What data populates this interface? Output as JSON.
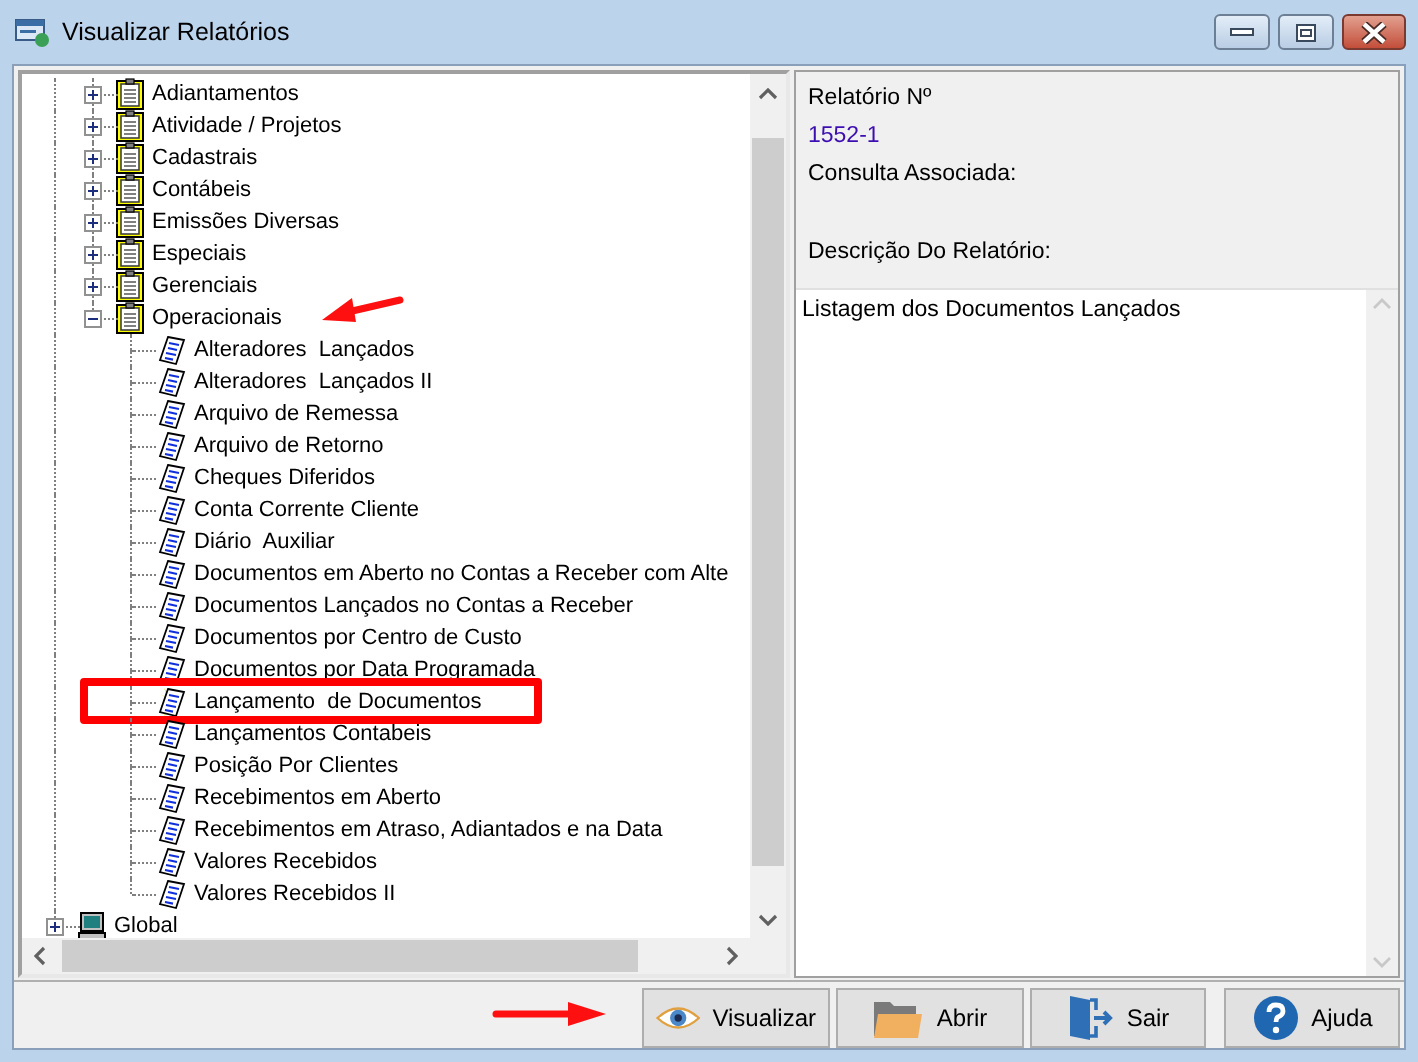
{
  "window": {
    "title": "Visualizar Relatórios"
  },
  "tree": [
    {
      "children": [
        {
          "label": "Adiantamentos",
          "kind": "category",
          "expanded": false
        },
        {
          "label": "Atividade / Projetos",
          "kind": "category",
          "expanded": false
        },
        {
          "label": "Cadastrais",
          "kind": "category",
          "expanded": false
        },
        {
          "label": "Contábeis",
          "kind": "category",
          "expanded": false
        },
        {
          "label": "Emissões Diversas",
          "kind": "category",
          "expanded": false
        },
        {
          "label": "Especiais",
          "kind": "category",
          "expanded": false
        },
        {
          "label": "Gerenciais",
          "kind": "category",
          "expanded": false
        },
        {
          "label": "Operacionais",
          "kind": "category",
          "expanded": true,
          "children": [
            {
              "label": "Alteradores  Lançados",
              "kind": "report",
              "selected": false,
              "highlighted": false
            },
            {
              "label": "Alteradores  Lançados II",
              "kind": "report",
              "selected": false,
              "highlighted": false
            },
            {
              "label": "Arquivo de Remessa",
              "kind": "report",
              "selected": false,
              "highlighted": false
            },
            {
              "label": "Arquivo de Retorno",
              "kind": "report",
              "selected": false,
              "highlighted": false
            },
            {
              "label": "Cheques Diferidos",
              "kind": "report",
              "selected": false,
              "highlighted": false
            },
            {
              "label": "Conta Corrente Cliente",
              "kind": "report",
              "selected": false,
              "highlighted": false
            },
            {
              "label": "Diário  Auxiliar",
              "kind": "report",
              "selected": false,
              "highlighted": false
            },
            {
              "label": "Documentos em Aberto no Contas a Receber com Alte",
              "kind": "report",
              "selected": false,
              "highlighted": false
            },
            {
              "label": "Documentos Lançados no Contas a Receber",
              "kind": "report",
              "selected": false,
              "highlighted": false
            },
            {
              "label": "Documentos por Centro de Custo",
              "kind": "report",
              "selected": false,
              "highlighted": false
            },
            {
              "label": "Documentos por Data Programada",
              "kind": "report",
              "selected": false,
              "highlighted": false
            },
            {
              "label": "Lançamento  de Documentos",
              "kind": "report",
              "selected": true,
              "highlighted": true
            },
            {
              "label": "Lançamentos Contabeis",
              "kind": "report",
              "selected": false,
              "highlighted": false
            },
            {
              "label": "Posição Por Clientes",
              "kind": "report",
              "selected": false,
              "highlighted": false
            },
            {
              "label": "Recebimentos em Aberto",
              "kind": "report",
              "selected": false,
              "highlighted": false
            },
            {
              "label": "Recebimentos em Atraso, Adiantados e na Data",
              "kind": "report",
              "selected": false,
              "highlighted": false
            },
            {
              "label": "Valores Recebidos",
              "kind": "report",
              "selected": false,
              "highlighted": false
            },
            {
              "label": "Valores Recebidos II",
              "kind": "report",
              "selected": false,
              "highlighted": false
            }
          ]
        }
      ]
    },
    {
      "label": "Global",
      "kind": "computer",
      "expanded": false
    }
  ],
  "details": {
    "number_label": "Relatório Nº",
    "number": "1552-1",
    "query_label": "Consulta Associada:",
    "description_label": "Descrição Do Relatório:",
    "description": "Listagem dos Documentos Lançados"
  },
  "buttons": [
    {
      "label": "Visualizar",
      "kind": "view"
    },
    {
      "label": "Abrir",
      "kind": "open"
    },
    {
      "label": "Sair",
      "kind": "exit"
    },
    {
      "label": "Ajuda",
      "kind": "help"
    }
  ]
}
